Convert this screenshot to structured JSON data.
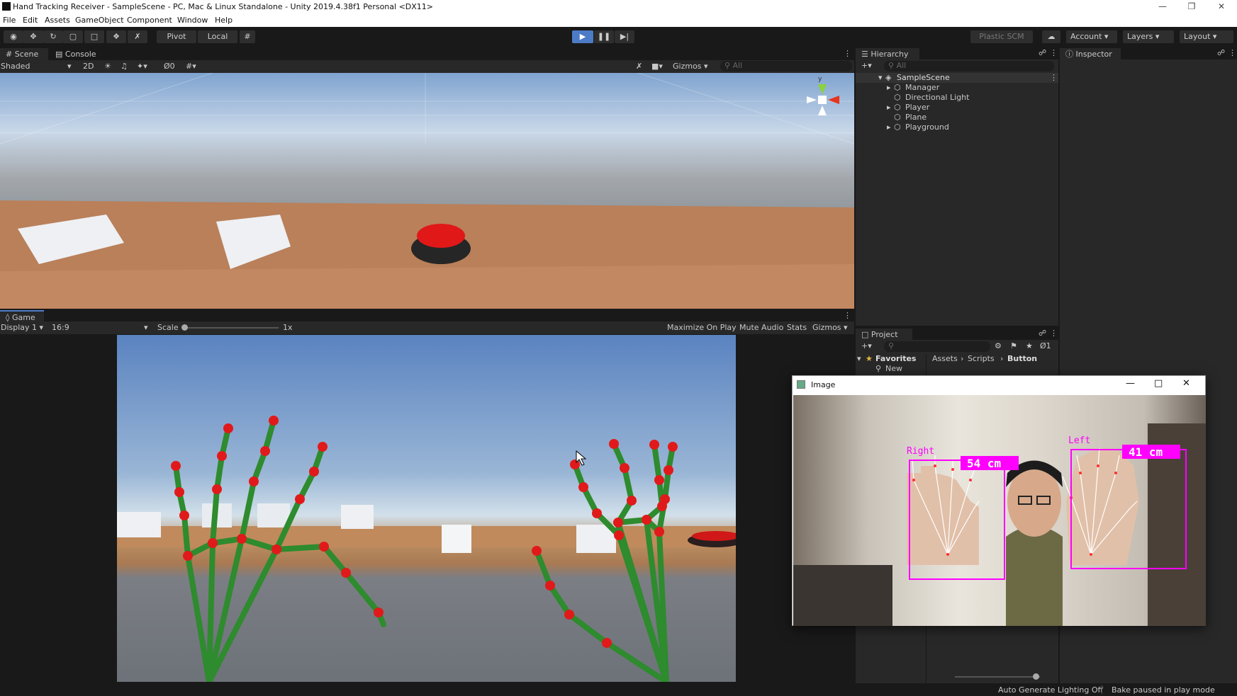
{
  "window": {
    "title": "Hand Tracking Receiver - SampleScene - PC, Mac & Linux Standalone - Unity 2019.4.38f1 Personal <DX11>"
  },
  "menu": [
    "File",
    "Edit",
    "Assets",
    "GameObject",
    "Component",
    "Window",
    "Help"
  ],
  "toolbar": {
    "pivot": "Pivot",
    "local": "Local",
    "plastic": "Plastic SCM",
    "account": "Account",
    "layers": "Layers",
    "layout": "Layout"
  },
  "scene_tabs": {
    "scene": "Scene",
    "console": "Console"
  },
  "scene_bar": {
    "shading": "Shaded",
    "mode2d": "2D",
    "hidden_count": "0",
    "gizmos": "Gizmos",
    "search": "All"
  },
  "gizmo_axis": {
    "y": "y"
  },
  "game": {
    "tab": "Game",
    "display": "Display 1",
    "aspect": "16:9",
    "scale_label": "Scale",
    "scale_value": "1x",
    "maximize": "Maximize On Play",
    "mute": "Mute Audio",
    "stats": "Stats",
    "gizmos": "Gizmos"
  },
  "hierarchy": {
    "title": "Hierarchy",
    "search": "All",
    "scene": "SampleScene",
    "items": [
      "Manager",
      "Directional Light",
      "Player",
      "Plane",
      "Playground"
    ]
  },
  "inspector": {
    "title": "Inspector"
  },
  "project": {
    "title": "Project",
    "favorites": "Favorites",
    "fav_item": "New Saved",
    "breadcrumb": [
      "Assets",
      "Scripts",
      "Button"
    ],
    "hidden_count": "1"
  },
  "image_window": {
    "title": "Image",
    "right_label": "Right",
    "right_dist": "54 cm",
    "left_label": "Left",
    "left_dist": "41 cm"
  },
  "status": {
    "lighting": "Auto Generate Lighting Off",
    "bake": "Bake paused in play mode"
  },
  "colors": {
    "accent": "#4d7cc7",
    "ground": "#b5805e",
    "button_red": "#e01818",
    "hand_green": "#2e8b2e",
    "joint_red": "#e01a1a",
    "label_magenta": "#ff00ff"
  }
}
